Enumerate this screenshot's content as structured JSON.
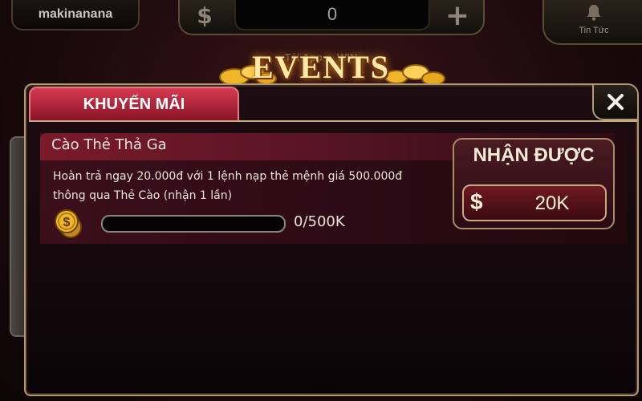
{
  "topbar": {
    "username": "makinanana",
    "currency_symbol": "$",
    "balance": "0",
    "add_symbol": "+",
    "news_label": "Tin Tức"
  },
  "banner": {
    "subtitle": "Tải App ... WIN",
    "title": "EVENTS"
  },
  "dialog": {
    "tab_label": "KHUYẾN MÃI",
    "close_symbol": "✕",
    "event": {
      "title": "Cào Thẻ Thả Ga",
      "description": "Hoàn trả ngay 20.000đ với 1 lệnh nạp thẻ mệnh giá 500.000đ thông qua Thẻ Cào (nhận 1 lần)",
      "progress_text": "0/500K",
      "progress_fraction": 0
    },
    "reward": {
      "heading": "NHẬN ĐƯỢC",
      "currency_symbol": "$",
      "value": "20K"
    }
  },
  "colors": {
    "accent_red": "#c8283e",
    "gold": "#c8aa82",
    "coin_gold": "#f0b62a"
  },
  "icons": [
    "bell-icon",
    "coin-icon",
    "close-icon",
    "dollar-icon",
    "plus-icon"
  ]
}
